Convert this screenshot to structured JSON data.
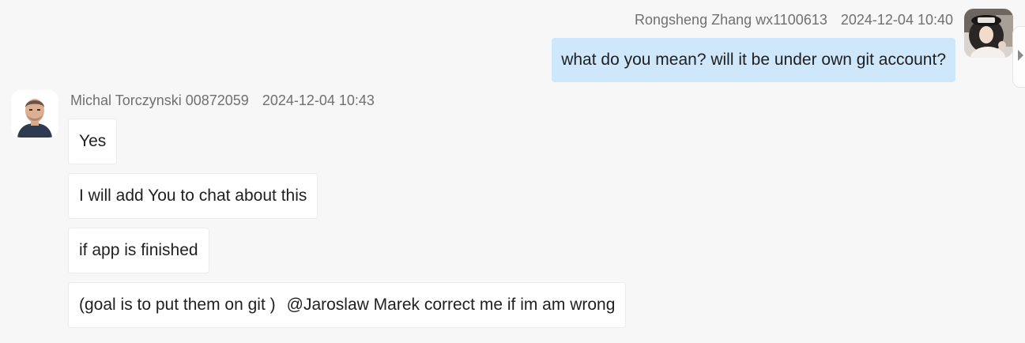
{
  "messages": [
    {
      "direction": "outgoing",
      "sender": "Rongsheng Zhang wx1100613",
      "timestamp": "2024-12-04 10:40",
      "avatar": "woman-with-hat-avatar",
      "bubbles": [
        {
          "text": "what do you mean? will it be under own git account?"
        }
      ],
      "bubble_color": "#cfe7fb"
    },
    {
      "direction": "incoming",
      "sender": "Michal Torczynski 00872059",
      "timestamp": "2024-12-04 10:43",
      "avatar": "man-portrait-avatar",
      "bubbles": [
        {
          "text": "Yes"
        },
        {
          "text": "I will add You to chat about this"
        },
        {
          "text": "if app is finished"
        },
        {
          "text": "(goal is to put them on git )",
          "mention": "@Jaroslaw Marek correct me if im am wrong"
        }
      ],
      "bubble_color": "#ffffff"
    }
  ],
  "colors": {
    "background": "#f7f7f7",
    "meta_text": "#707070",
    "message_text": "#1f1f1f"
  }
}
